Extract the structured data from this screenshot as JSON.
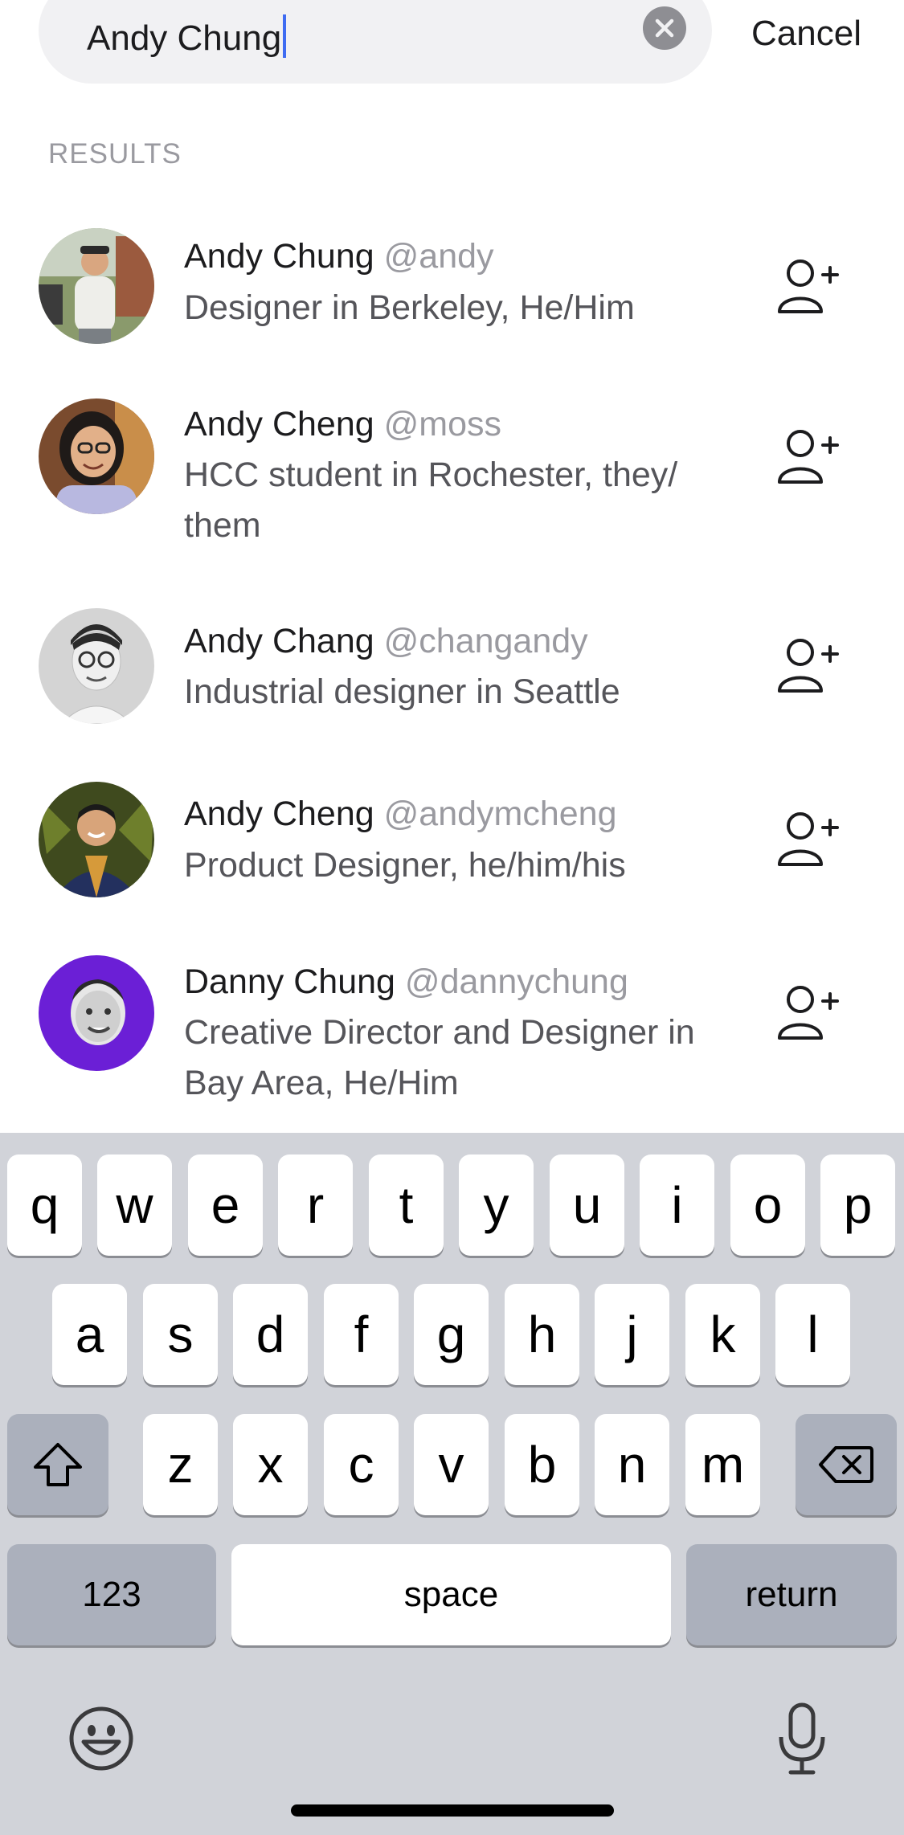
{
  "search": {
    "query": "Andy Chung",
    "cancel_label": "Cancel"
  },
  "results_label": "RESULTS",
  "results": [
    {
      "name": "Andy Chung",
      "handle": "@andy",
      "bio": "Designer in Berkeley, He/Him"
    },
    {
      "name": "Andy Cheng",
      "handle": "@moss",
      "bio": "HCC student in Rochester, they/ them"
    },
    {
      "name": "Andy Chang",
      "handle": "@changandy",
      "bio": "Industrial designer in Seattle"
    },
    {
      "name": "Andy Cheng",
      "handle": "@andymcheng",
      "bio": "Product Designer, he/him/his"
    },
    {
      "name": "Danny Chung",
      "handle": "@dannychung",
      "bio": "Creative Director and Designer in Bay Area, He/Him"
    }
  ],
  "keyboard": {
    "row1": [
      "q",
      "w",
      "e",
      "r",
      "t",
      "y",
      "u",
      "i",
      "o",
      "p"
    ],
    "row2": [
      "a",
      "s",
      "d",
      "f",
      "g",
      "h",
      "j",
      "k",
      "l"
    ],
    "row3": [
      "z",
      "x",
      "c",
      "v",
      "b",
      "n",
      "m"
    ],
    "numbers_label": "123",
    "space_label": "space",
    "return_label": "return"
  },
  "icons": {
    "clear": "clear-circle-icon",
    "add_friend": "person-plus-icon",
    "shift": "shift-arrow-icon",
    "delete": "backspace-icon",
    "emoji": "emoji-smile-icon",
    "mic": "microphone-icon"
  }
}
